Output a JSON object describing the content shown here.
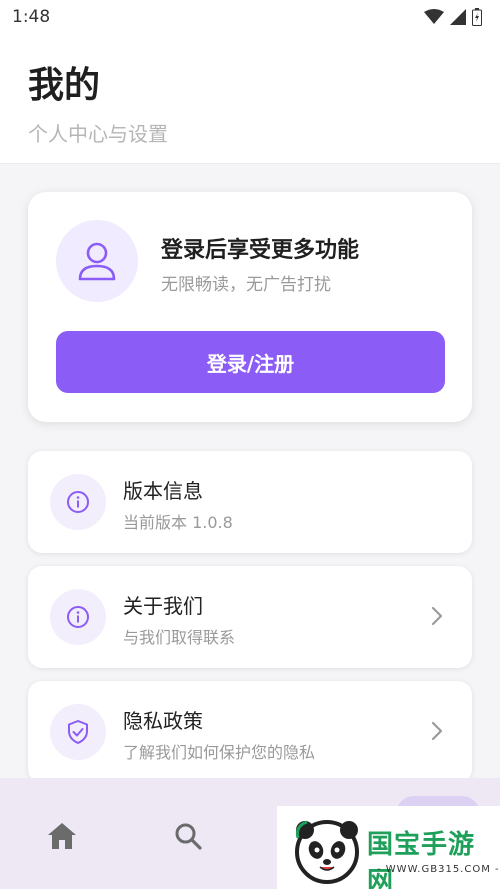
{
  "status_bar": {
    "time": "1:48"
  },
  "header": {
    "title": "我的",
    "subtitle": "个人中心与设置"
  },
  "login_card": {
    "title": "登录后享受更多功能",
    "subtitle": "无限畅读，无广告打扰",
    "button_label": "登录/注册"
  },
  "menu": [
    {
      "title": "版本信息",
      "subtitle": "当前版本 1.0.8",
      "icon": "info-icon"
    },
    {
      "title": "关于我们",
      "subtitle": "与我们取得联系",
      "icon": "info-icon"
    },
    {
      "title": "隐私政策",
      "subtitle": "了解我们如何保护您的隐私",
      "icon": "shield-check-icon"
    }
  ],
  "bottom_nav": {
    "items": [
      "home-icon",
      "search-icon",
      "profile-icon"
    ]
  },
  "watermark": {
    "text": "国宝手游网",
    "url": "- WWW.GB315.COM -"
  },
  "colors": {
    "accent": "#8b5cf6",
    "accent_light": "#f0ebff",
    "nav_bg": "#ede8f3"
  }
}
